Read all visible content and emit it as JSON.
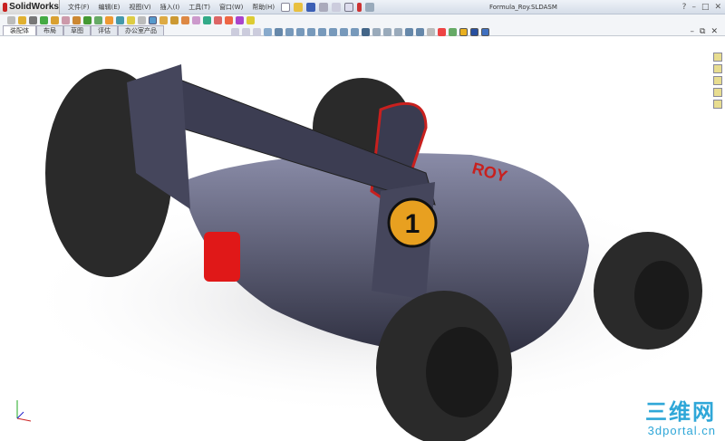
{
  "app": {
    "name": "SolidWorks",
    "document_title": "Formula_Roy.SLDASM"
  },
  "menu": [
    "文件(F)",
    "编辑(E)",
    "视图(V)",
    "插入(I)",
    "工具(T)",
    "窗口(W)",
    "帮助(H)"
  ],
  "window_controls": {
    "help": "?",
    "minimize": "–",
    "maximize": "□",
    "close": "✕"
  },
  "tabs": [
    {
      "label": "装配体",
      "active": true
    },
    {
      "label": "布局"
    },
    {
      "label": "草图"
    },
    {
      "label": "评估"
    },
    {
      "label": "办公室产品"
    }
  ],
  "model": {
    "number": "1",
    "sponsor": "ROY"
  },
  "watermark": {
    "line1": "三维网",
    "line2": "3dportal.cn"
  },
  "colors": {
    "accent": "#c8201e",
    "body": "#4a4b63",
    "tire": "#2a2a2a",
    "watermark": "#2fa7d8"
  }
}
